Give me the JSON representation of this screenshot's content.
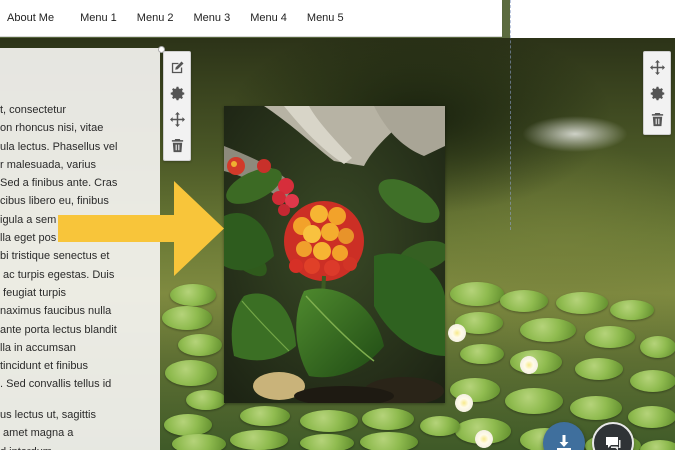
{
  "nav": {
    "items": [
      "About Me",
      "Menu 1",
      "Menu 2",
      "Menu 3",
      "Menu 4",
      "Menu 5"
    ]
  },
  "text_panel": {
    "paragraph1": [
      "t, consectetur",
      "on rhoncus nisi, vitae",
      "ula lectus. Phasellus vel",
      "r malesuada, varius",
      "Sed a finibus ante. Cras",
      "cibus libero eu, finibus",
      "igula a sem efficitur",
      "lla eget pos",
      "bi tristique senectus et",
      " ac turpis egestas. Duis",
      " feugiat turpis",
      "naximus faucibus nulla",
      "ante porta lectus blandit",
      "lla in accumsan",
      "tincidunt et finibus",
      ". Sed convallis tellus id"
    ],
    "paragraph2": [
      "us lectus ut, sagittis",
      " amet magna a",
      "d interdum"
    ]
  },
  "toolbar_left": {
    "buttons": [
      "edit-icon",
      "gear-icon",
      "move-icon",
      "trash-icon"
    ]
  },
  "toolbar_right": {
    "buttons": [
      "move-icon",
      "gear-icon",
      "trash-icon"
    ]
  },
  "arrow": {
    "color": "#F8C53A"
  },
  "fabs": [
    {
      "name": "download-icon",
      "color": "#3F6F9D"
    },
    {
      "name": "chat-icon",
      "color": "#2F3336"
    }
  ]
}
